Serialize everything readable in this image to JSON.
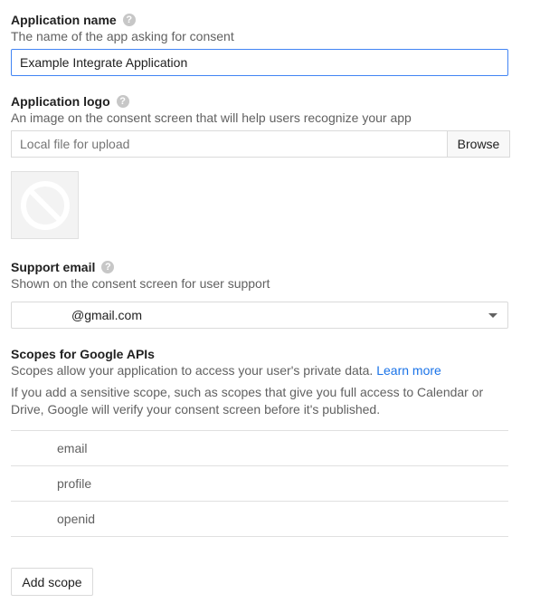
{
  "app_name": {
    "title": "Application name",
    "help": "?",
    "description": "The name of the app asking for consent",
    "value": "Example Integrate Application"
  },
  "app_logo": {
    "title": "Application logo",
    "help": "?",
    "description": "An image on the consent screen that will help users recognize your app",
    "file_placeholder": "Local file for upload",
    "browse_label": "Browse",
    "preview_icon": "no-image-icon"
  },
  "support_email": {
    "title": "Support email",
    "help": "?",
    "description": "Shown on the consent screen for user support",
    "value": "@gmail.com",
    "dropdown_icon": "caret-down-icon"
  },
  "scopes": {
    "title": "Scopes for Google APIs",
    "description": "Scopes allow your application to access your user's private data.",
    "learn_more": "Learn more",
    "notice": "If you add a sensitive scope, such as scopes that give you full access to Calendar or Drive, Google will verify your consent screen before it's published.",
    "items": [
      {
        "name": "email"
      },
      {
        "name": "profile"
      },
      {
        "name": "openid"
      }
    ],
    "add_label": "Add scope"
  },
  "colors": {
    "link": "#1a73e8",
    "focus_border": "#4285f4",
    "help_icon": "#c7c7c7"
  }
}
